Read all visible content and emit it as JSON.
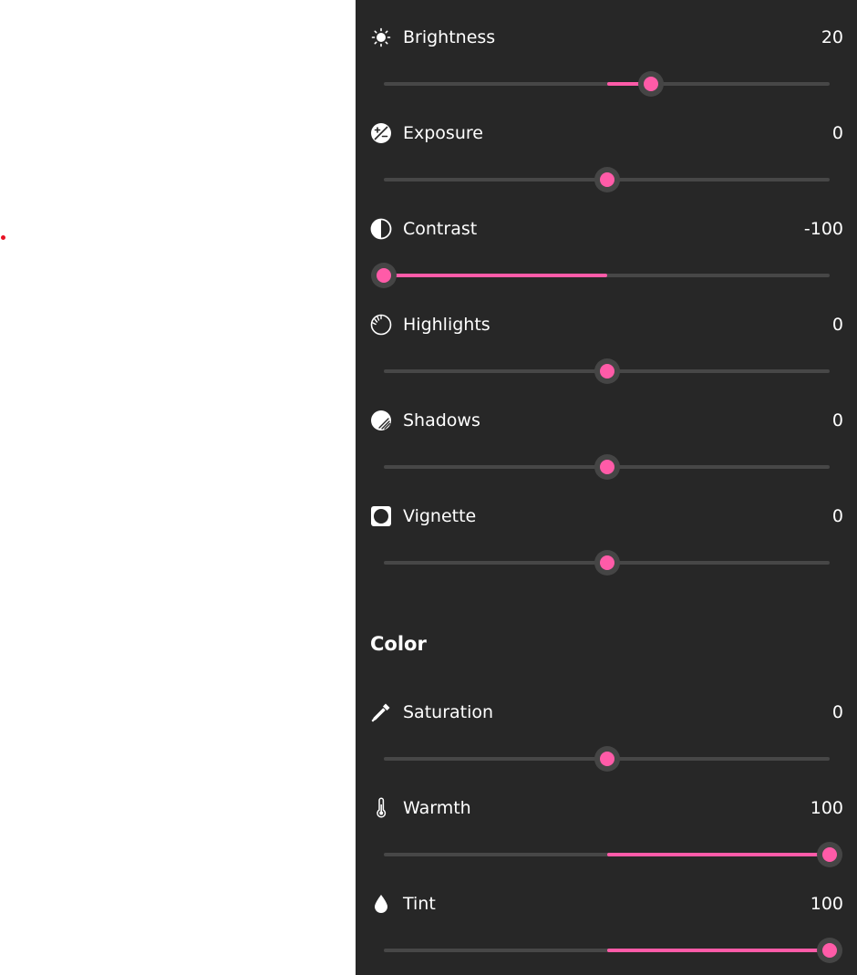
{
  "panel": {
    "accent_color": "#ff5ba8",
    "background_color": "#272727",
    "light_adjustments": [
      {
        "label": "Brightness",
        "value": "20",
        "icon": "brightness-icon",
        "level": 20
      },
      {
        "label": "Exposure",
        "value": "0",
        "icon": "exposure-icon",
        "level": 0
      },
      {
        "label": "Contrast",
        "value": "-100",
        "icon": "contrast-icon",
        "level": -100
      },
      {
        "label": "Highlights",
        "value": "0",
        "icon": "highlights-icon",
        "level": 0
      },
      {
        "label": "Shadows",
        "value": "0",
        "icon": "shadows-icon",
        "level": 0
      },
      {
        "label": "Vignette",
        "value": "0",
        "icon": "vignette-icon",
        "level": 0
      }
    ],
    "color_section_title": "Color",
    "color_adjustments": [
      {
        "label": "Saturation",
        "value": "0",
        "icon": "eyedropper-icon",
        "level": 0
      },
      {
        "label": "Warmth",
        "value": "100",
        "icon": "thermometer-icon",
        "level": 100
      },
      {
        "label": "Tint",
        "value": "100",
        "icon": "droplet-icon",
        "level": 100
      }
    ],
    "slider_range": [
      -100,
      100
    ]
  }
}
